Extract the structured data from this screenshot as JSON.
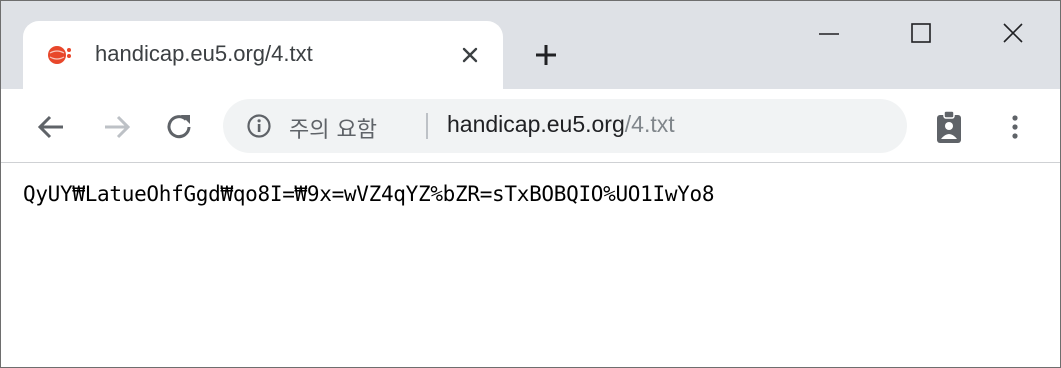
{
  "tab": {
    "title": "handicap.eu5.org/4.txt",
    "favicon": "red-globe-favicon-icon"
  },
  "window_controls": [
    "minimize-icon",
    "maximize-icon",
    "close-icon"
  ],
  "toolbar": {
    "back": "back-arrow-icon",
    "forward": "forward-arrow-icon",
    "reload": "reload-icon"
  },
  "omnibox": {
    "security_label": "주의 요함",
    "url_host": "handicap.eu5.org",
    "url_path": "/4.txt"
  },
  "page": {
    "text": "QyUY₩LatueOhfGgd₩qo8I=₩9x=wVZ4qYZ%bZR=sTxBOBQIO%UO1IwYo8"
  },
  "colors": {
    "tabstrip": "#dee1e6",
    "omnibox": "#f1f3f4",
    "favicon": "#e8472b"
  }
}
